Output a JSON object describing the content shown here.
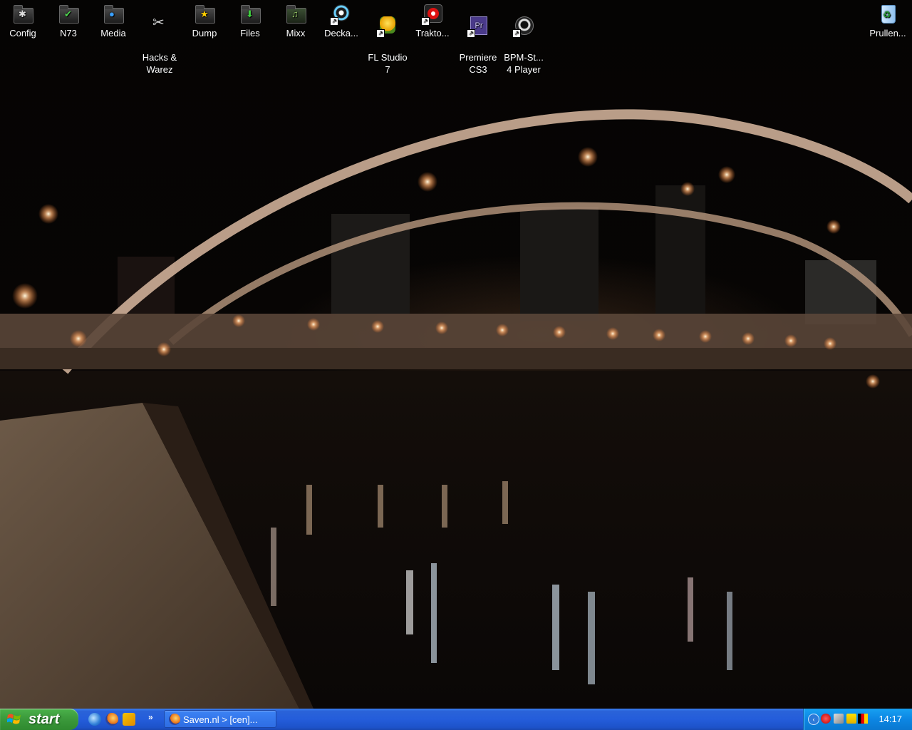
{
  "desktop": {
    "icons": [
      {
        "label": "Config",
        "icon": "config-folder-icon"
      },
      {
        "label": "N73",
        "icon": "n73-folder-icon"
      },
      {
        "label": "Media",
        "icon": "media-folder-icon"
      },
      {
        "label": "Hacks &\nWarez",
        "icon": "hacks-warez-tools-icon"
      },
      {
        "label": "Dump",
        "icon": "dump-folder-icon"
      },
      {
        "label": "Files",
        "icon": "files-folder-icon"
      },
      {
        "label": "Mixx",
        "icon": "mixx-icon"
      },
      {
        "label": "Decka...",
        "icon": "deckadance-shortcut-icon"
      },
      {
        "label": "FL Studio\n7",
        "icon": "fl-studio-shortcut-icon"
      },
      {
        "label": "Trakto...",
        "icon": "traktor-shortcut-icon"
      },
      {
        "label": "Premiere\nCS3",
        "icon": "premiere-cs3-shortcut-icon"
      },
      {
        "label": "BPM-St...\n4 Player",
        "icon": "bpm-studio-shortcut-icon"
      }
    ],
    "recycle_bin": {
      "label": "Prullen...",
      "icon": "recycle-bin-icon"
    },
    "wallpaper": "night-bridge-wallpaper"
  },
  "taskbar": {
    "start_label": "start",
    "quick_launch": [
      "internet-explorer-icon",
      "firefox-icon",
      "winamp-icon"
    ],
    "quick_launch_more": "»",
    "tasks": [
      {
        "label": "Saven.nl > [cen]...",
        "icon": "firefox-icon"
      }
    ],
    "tray_icons": [
      "tray-arrow-icon",
      "tray-network-icon",
      "tray-security-icon",
      "tray-zonealarm-icon",
      "tray-flag-icon"
    ],
    "clock": "14:17"
  }
}
